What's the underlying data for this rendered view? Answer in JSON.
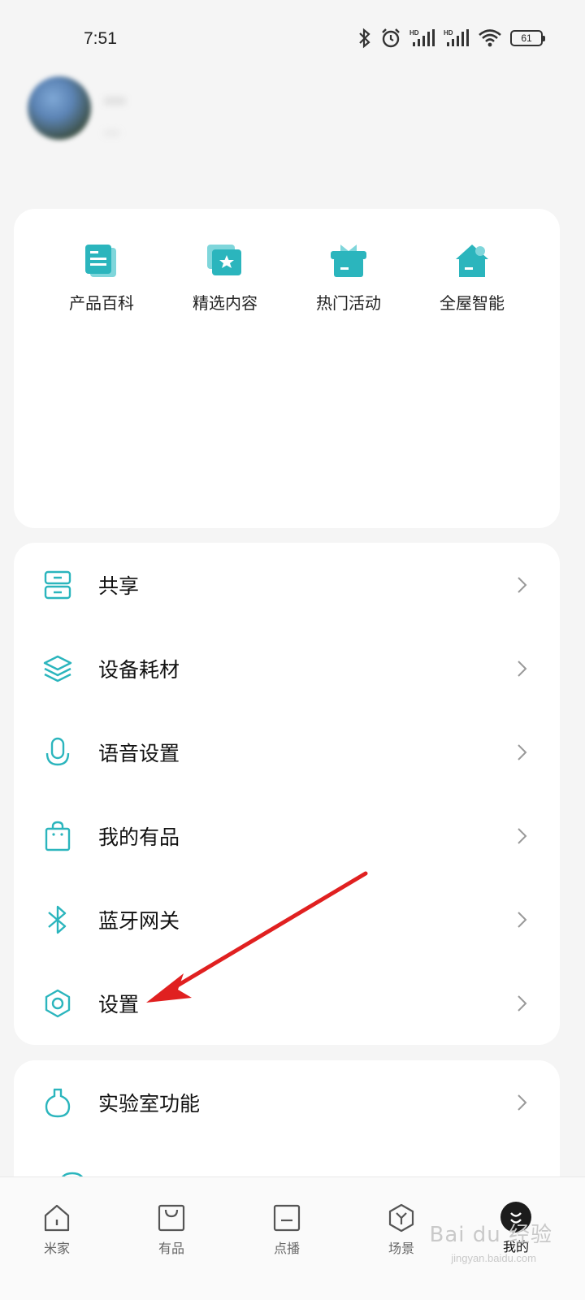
{
  "status_bar": {
    "time": "7:51",
    "battery": "61",
    "icons": [
      "bluetooth-icon",
      "alarm-icon",
      "hd-signal-icon",
      "hd-signal-icon",
      "wifi-icon",
      "battery-icon"
    ]
  },
  "profile": {
    "name": "...",
    "subtitle": "..."
  },
  "quick_links": [
    {
      "label": "产品百科",
      "icon": "product-book-icon"
    },
    {
      "label": "精选内容",
      "icon": "featured-content-icon"
    },
    {
      "label": "热门活动",
      "icon": "gift-icon"
    },
    {
      "label": "全屋智能",
      "icon": "smart-home-icon"
    }
  ],
  "menu": [
    {
      "label": "共享",
      "icon": "share-icon"
    },
    {
      "label": "设备耗材",
      "icon": "layers-icon"
    },
    {
      "label": "语音设置",
      "icon": "microphone-icon"
    },
    {
      "label": "我的有品",
      "icon": "shopping-bag-icon"
    },
    {
      "label": "蓝牙网关",
      "icon": "bluetooth-icon"
    },
    {
      "label": "设置",
      "icon": "settings-hexagon-icon"
    }
  ],
  "lab_menu": [
    {
      "label": "实验室功能",
      "icon": "flask-icon"
    }
  ],
  "tabs": [
    {
      "label": "米家",
      "icon": "home-icon"
    },
    {
      "label": "有品",
      "icon": "bag-icon"
    },
    {
      "label": "点播",
      "icon": "tv-icon"
    },
    {
      "label": "场景",
      "icon": "scene-icon"
    },
    {
      "label": "我的",
      "icon": "profile-icon"
    }
  ],
  "watermark": {
    "text": "Bai du 经验",
    "sub": "jingyan.baidu.com"
  },
  "colors": {
    "accent": "#2bb5bd",
    "accent_light": "#7fd6db",
    "arrow": "#e02020",
    "background": "#f5f5f5"
  }
}
